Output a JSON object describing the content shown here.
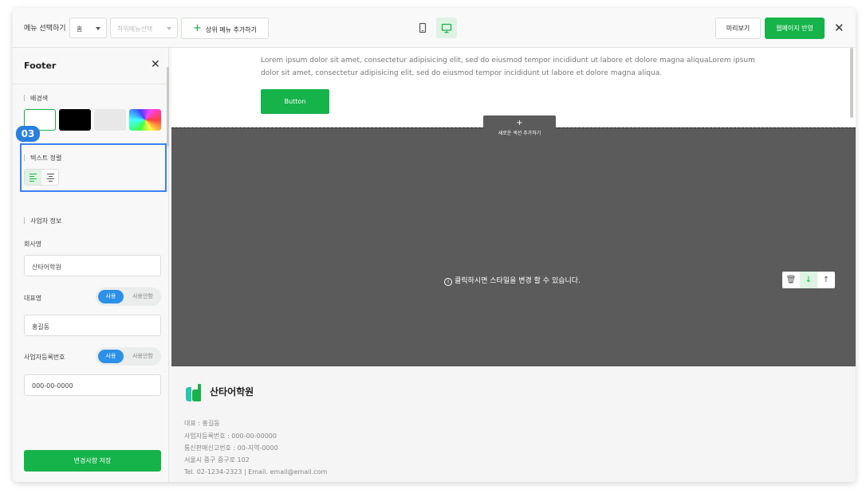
{
  "topbar": {
    "menu_label": "메뉴 선택하기",
    "top_menu_value": "홈",
    "sub_menu_placeholder": "하위메뉴선택",
    "add_top_menu": "상위 메뉴 추가하기",
    "preview": "미리보기",
    "publish": "웹페이지 반영"
  },
  "panel": {
    "title": "Footer",
    "bg_label": "배경색",
    "step_badge": "03",
    "align_label": "텍스트 정렬",
    "biz_label": "사업자 정보",
    "company_label": "회사명",
    "company_value": "산타어학원",
    "ceo_label": "대표명",
    "ceo_value": "홍길동",
    "regno_label": "사업자등록번호",
    "regno_value": "000-00-0000",
    "toggle_on": "사용",
    "toggle_off": "사용안함",
    "save": "변경사항 저장"
  },
  "canvas": {
    "lorem": "Lorem ipsum dolor sit amet, consectetur adipisicing elit, sed do eiusmod tempor incididunt ut labore et dolore magna aliquaLorem ipsum dolor sit amet, consectetur adipisicing elit, sed do eiusmod tempor incididunt ut labore et dolore magna aliqua.",
    "button": "Button",
    "add_section_plus": "+",
    "add_section": "새로운 섹션 추가하기",
    "click_message": "클릭하시면 스타일을 변경 할 수 있습니다.",
    "info_glyph": "!",
    "tool_delete": "🗑",
    "tool_down": "↓",
    "tool_up": "↑"
  },
  "footer": {
    "brand": "산타어학원",
    "ceo": "대표 : 홍길동",
    "regno": "사업자등록번호 : 000-00-00000",
    "mail_order": "통신판매신고번호 : 00-지역-0000",
    "address": "서울시 중구 중구로 102",
    "contact": "Tel. 02-1234-2323 | Email. email@email.com"
  },
  "colors": {
    "accent_green": "#16b34a",
    "highlight_blue": "#3b82f6",
    "dark_section": "#5a5b5a"
  }
}
